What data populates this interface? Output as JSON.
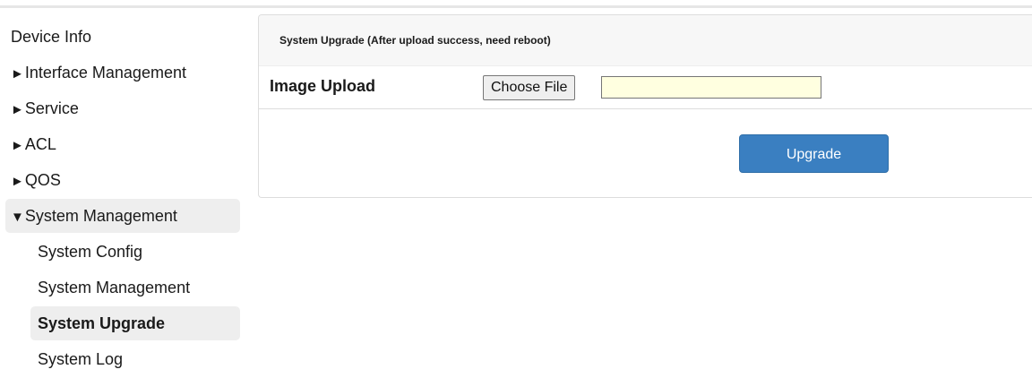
{
  "sidebar": {
    "items": [
      {
        "label": "Device Info",
        "arrow": ""
      },
      {
        "label": "Interface Management",
        "arrow": "►"
      },
      {
        "label": "Service",
        "arrow": "►"
      },
      {
        "label": "ACL",
        "arrow": "►"
      },
      {
        "label": "QOS",
        "arrow": "►"
      },
      {
        "label": "System Management",
        "arrow": "▼"
      }
    ],
    "subitems": [
      {
        "label": "System Config"
      },
      {
        "label": "System Management"
      },
      {
        "label": "System Upgrade"
      },
      {
        "label": "System Log"
      }
    ]
  },
  "panel": {
    "title": "System Upgrade  (After upload success, need reboot)",
    "image_upload_label": "Image Upload",
    "choose_file_label": "Choose File",
    "file_value": "",
    "upgrade_label": "Upgrade"
  }
}
